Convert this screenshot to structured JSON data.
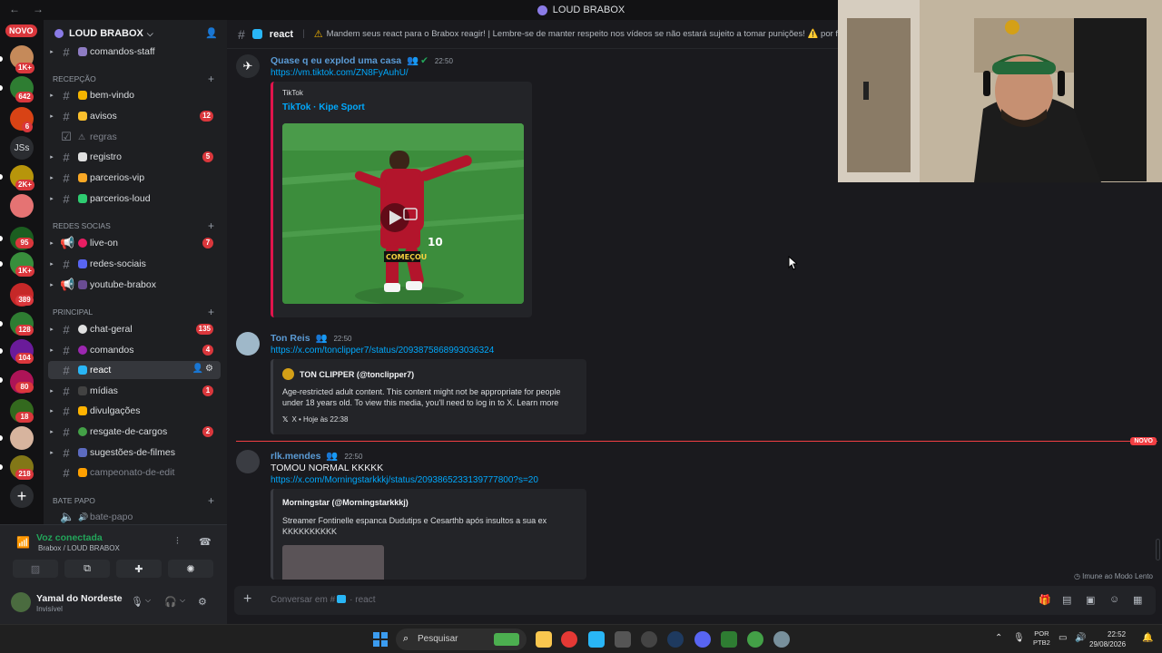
{
  "window": {
    "title": "LOUD BRABOX"
  },
  "rail": {
    "novo": "NOVO",
    "jss": "JSs",
    "badges": [
      "1K+",
      "642",
      "6",
      "2K+",
      "95",
      "1K+",
      "389",
      "128",
      "104",
      "80",
      "18",
      "218"
    ]
  },
  "server": {
    "name": "LOUD BRABOX"
  },
  "categories": {
    "recepcao": "RECEPÇÃO",
    "redes": "REDES SOCIAS",
    "principal": "PRINCIPAL",
    "bate": "BATE PAPO"
  },
  "channels": [
    {
      "name": "comandos-staff"
    },
    {
      "name": "bem-vindo"
    },
    {
      "name": "avisos",
      "badge": "12"
    },
    {
      "name": "regras"
    },
    {
      "name": "registro",
      "badge": "5"
    },
    {
      "name": "parcerios-vip"
    },
    {
      "name": "parcerios-loud"
    },
    {
      "name": "live-on",
      "badge": "7"
    },
    {
      "name": "redes-sociais"
    },
    {
      "name": "youtube-brabox"
    },
    {
      "name": "chat-geral",
      "badge": "135"
    },
    {
      "name": "comandos",
      "badge": "4"
    },
    {
      "name": "react"
    },
    {
      "name": "mídias",
      "badge": "1"
    },
    {
      "name": "divulgações"
    },
    {
      "name": "resgate-de-cargos",
      "badge": "2"
    },
    {
      "name": "sugestões-de-filmes"
    },
    {
      "name": "campeonato-de-edit"
    },
    {
      "name": "bate-papo"
    }
  ],
  "voice": {
    "title": "Voz conectada",
    "subtitle": "Brabox / LOUD BRABOX"
  },
  "user": {
    "name": "Yamal do Nordeste",
    "status": "Invisível"
  },
  "header": {
    "channel": "react",
    "topic": "Mandem seus react para o Brabox reagir! | Lembre-se de manter respeito nos vídeos se não estará sujeito a tomar punições! ⚠️ por favor não"
  },
  "messages": [
    {
      "author": "Quase q eu explod uma casa",
      "time": "22:50",
      "link": "https://vm.tiktok.com/ZN8FyAuhU/",
      "embed": {
        "provider": "TikTok",
        "title": "TikTok · Kipe Sport",
        "overlay": "COMEÇOU",
        "jersey": "10"
      }
    },
    {
      "author": "Ton Reis",
      "time": "22:50",
      "link": "https://x.com/tonclipper7/status/2093875868993036324",
      "embed": {
        "author": "TON CLIPPER (@tonclipper7)",
        "desc1": "Age-restricted adult content. This content might not be appropriate for people",
        "desc2": "under 18 years old. To view this media, you'll need to log in to X. Learn more",
        "footer": "X • Hoje às 22:38"
      }
    },
    {
      "author": "rlk.mendes",
      "time": "22:50",
      "text": "TOMOU NORMAL KKKKK",
      "link": "https://x.com/Morningstarkkkj/status/2093865233139777800?s=20",
      "embed": {
        "author": "Morningstar (@Morningstarkkkj)",
        "desc1": "Streamer Fontinelle espanca Dudutips e Cesarthb após insultos a sua ex",
        "desc2": "KKKKKKKKKK"
      }
    }
  ],
  "new_tag": "NOVO",
  "slowmode": "Imune ao Modo Lento",
  "composer": {
    "placeholder": "Conversar em #",
    "channel": "react"
  },
  "taskbar": {
    "search": "Pesquisar",
    "lang1": "POR",
    "lang2": "PTB2",
    "time": "22:52",
    "date": "29/08/2026"
  },
  "colors": {
    "accent": "#00a8fc",
    "badge": "#da373c",
    "online": "#23a55a",
    "tiktok": "#e0144c"
  }
}
